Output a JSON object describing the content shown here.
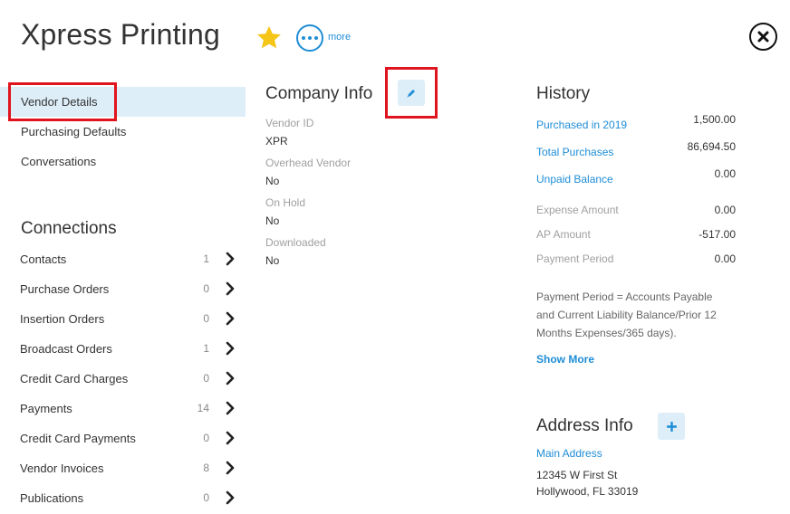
{
  "header": {
    "title": "Xpress Printing",
    "more_label": "more"
  },
  "colors": {
    "accent": "#1f8dd6",
    "star": "#f5c518",
    "highlight": "#e0141e",
    "active_bg": "#ddeef9"
  },
  "nav": {
    "items": [
      {
        "label": "Vendor Details",
        "active": true
      },
      {
        "label": "Purchasing Defaults",
        "active": false
      },
      {
        "label": "Conversations",
        "active": false
      }
    ]
  },
  "connections": {
    "title": "Connections",
    "items": [
      {
        "label": "Contacts",
        "count": "1"
      },
      {
        "label": "Purchase Orders",
        "count": "0"
      },
      {
        "label": "Insertion Orders",
        "count": "0"
      },
      {
        "label": "Broadcast Orders",
        "count": "1"
      },
      {
        "label": "Credit Card Charges",
        "count": "0"
      },
      {
        "label": "Payments",
        "count": "14"
      },
      {
        "label": "Credit Card Payments",
        "count": "0"
      },
      {
        "label": "Vendor Invoices",
        "count": "8"
      },
      {
        "label": "Publications",
        "count": "0"
      }
    ]
  },
  "company": {
    "title": "Company Info",
    "fields": [
      {
        "label": "Vendor ID",
        "value": "XPR"
      },
      {
        "label": "Overhead Vendor",
        "value": "No"
      },
      {
        "label": "On Hold",
        "value": "No"
      },
      {
        "label": "Downloaded",
        "value": "No"
      }
    ]
  },
  "history": {
    "title": "History",
    "rows": [
      {
        "label": "Purchased in 2019",
        "value": "1,500.00",
        "link": true
      },
      {
        "label": "Total Purchases",
        "value": "86,694.50",
        "link": true
      },
      {
        "label": "Unpaid Balance",
        "value": "0.00",
        "link": true
      },
      {
        "label": "Expense Amount",
        "value": "0.00",
        "link": false
      },
      {
        "label": "AP Amount",
        "value": "-517.00",
        "link": false
      },
      {
        "label": "Payment Period",
        "value": "0.00",
        "link": false
      }
    ],
    "note": "Payment Period = Accounts Payable and Current Liability Balance/Prior 12 Months Expenses/365 days).",
    "show_more": "Show More"
  },
  "address": {
    "title": "Address Info",
    "link": "Main Address",
    "line1": "12345 W First St",
    "line2": "Hollywood, FL  33019"
  },
  "icons": {
    "star": "star-icon",
    "more": "ellipsis-icon",
    "close": "close-icon",
    "edit": "pencil-icon",
    "add": "plus-icon",
    "chevron": "chevron-right-icon"
  }
}
